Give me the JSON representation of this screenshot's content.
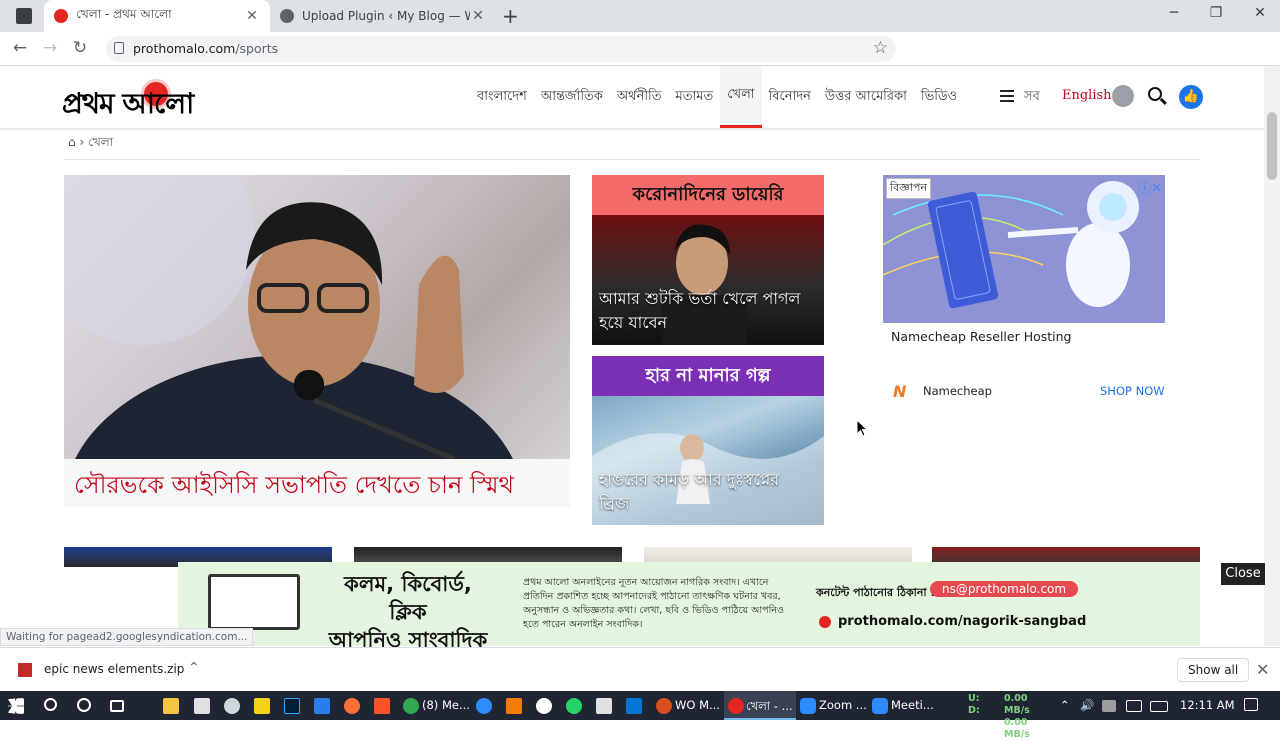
{
  "browser": {
    "tabs": [
      {
        "title": "খেলা - প্রথম আলো",
        "active": true
      },
      {
        "title": "Upload Plugin ‹ My Blog — Wor",
        "active": false
      }
    ],
    "url_host": "prothomalo.com",
    "url_path": "/sports"
  },
  "site": {
    "logo_text": "প্রথম আলো",
    "nav": [
      "বাংলাদেশ",
      "আন্তর্জাতিক",
      "অর্থনীতি",
      "মতামত",
      "খেলা",
      "বিনোদন",
      "উত্তর আমেরিকা",
      "ভিডিও"
    ],
    "nav_active": "খেলা",
    "all_label": "সব",
    "english_label": "English",
    "breadcrumb": "খেলা"
  },
  "lead_story": {
    "headline": "সৌরভকে আইসিসি সভাপতি দেখতে চান স্মিথ"
  },
  "cards": [
    {
      "band": "করোনাদিনের ডায়েরি",
      "band_color": "#f26a6a",
      "caption_line1": "আমার শুটকি ভর্তা খেলে পাগল",
      "caption_line2": "হয়ে যাবেন"
    },
    {
      "band": "হার না মানার গল্প",
      "band_color": "#7a2fb5",
      "caption_line1": "হাঙরের কামড় আর দুঃস্বপ্নের",
      "caption_line2": "ব্রিজ"
    }
  ],
  "ad": {
    "tag": "বিজ্ঞাপন",
    "close": "ⓘ✕",
    "title": "Namecheap Reseller Hosting",
    "brand": "Namecheap",
    "cta": "SHOP NOW"
  },
  "banner": {
    "headline_line1": "কলম, কিবোর্ড, ক্লিক",
    "headline_line2": "আপনিও সাংবাদিক",
    "body": "প্রথম আলো অনলাইনের নূতন আয়োজন নাগরিক সংবাদ। এখানে প্রতিদিন প্রকাশিত হচ্ছে আপনাদেরই পাঠানো তাৎক্ষণিক ঘটনার খবর, অনুসন্ধান ও অভিজ্ঞতার কথা। লেখা, ছবি ও ভিডিও পাঠিয়ে আপনিও হতে পারেন অনলাইন সংবাদিক।",
    "contact_label": "কনটেন্ট পাঠানোর ঠিকানা :",
    "email": "ns@prothomalo.com",
    "link": "prothomalo.com/nagorik-sangbad",
    "close": "Close"
  },
  "status_text": "Waiting for pagead2.googlesyndication.com...",
  "downloads": {
    "file": "epic news elements.zip",
    "show_all": "Show all"
  },
  "taskbar": {
    "items": [
      {
        "label": "(8) Me..."
      },
      {
        "label": "WO M..."
      },
      {
        "label": "খেলা - ..."
      },
      {
        "label": "Zoom ..."
      },
      {
        "label": "Meeti..."
      }
    ],
    "net_up_label": "U:",
    "net_down_label": "D:",
    "net_up": "0.00 MB/s",
    "net_down": "0.00 MB/s",
    "time": "12:11 AM"
  }
}
